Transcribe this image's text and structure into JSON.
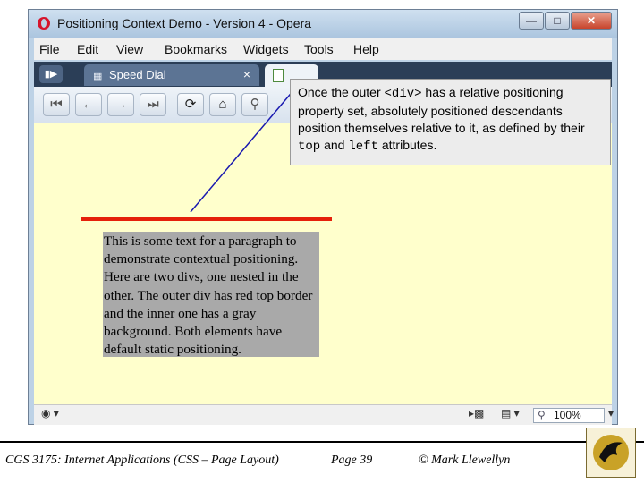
{
  "window": {
    "title": "Positioning Context Demo - Version 4 - Opera",
    "controls": {
      "minimize": "—",
      "maximize": "□",
      "close": "✕"
    }
  },
  "menu": [
    "File",
    "Edit",
    "View",
    "Bookmarks",
    "Widgets",
    "Tools",
    "Help"
  ],
  "tabs": {
    "toggle_icon": "panel-toggle-icon",
    "speed_dial": {
      "label": "Speed Dial",
      "close": "×"
    }
  },
  "status": {
    "zoom": "100%"
  },
  "callout": {
    "parts": [
      "Once the outer ",
      "<div>",
      " has a relative positioning property set, absolutely positioned descendants position themselves relative to it, as defined by their ",
      "top",
      " and ",
      "left",
      " attributes."
    ]
  },
  "page": {
    "paragraph": "This is some text for a paragraph to demonstrate contextual positioning. Here are two divs, one nested in the other. The outer div has red top border and the inner one has a gray background. Both elements have default static positioning.",
    "red_border_color": "#e5200a",
    "gray_background_color": "#a9a9a9",
    "content_background_color": "#ffffcc"
  },
  "footer": {
    "course": "CGS 3175: Internet Applications (CSS – Page Layout)",
    "page": "Page 39",
    "author": "© Mark Llewellyn"
  },
  "colors": {
    "opera_red": "#d6142b",
    "tab_bar": "#2b3e57",
    "close_button": "#c8442c"
  }
}
